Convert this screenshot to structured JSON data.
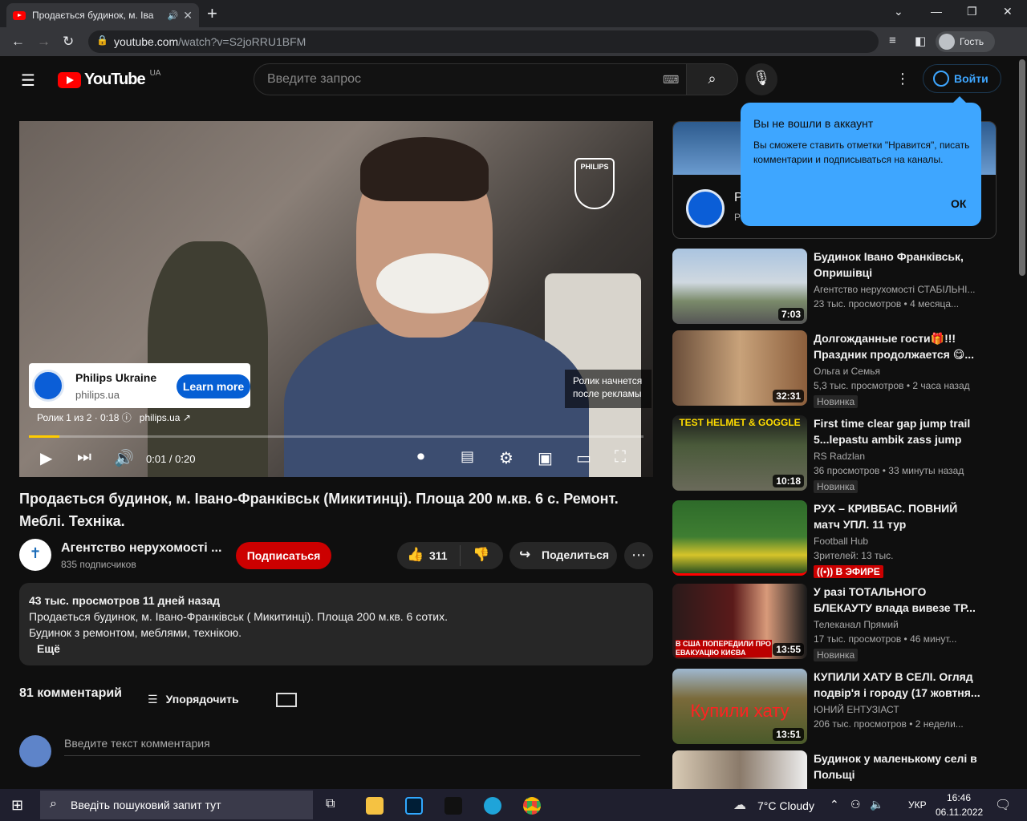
{
  "browser": {
    "tab_title": "Продається будинок, м. Іва",
    "url_host": "youtube.com",
    "url_path": "/watch?v=S2joRRU1BFM",
    "guest_label": "Гость"
  },
  "yt": {
    "logo": "YouTube",
    "region": "UA",
    "search_placeholder": "Введите запрос",
    "signin": "Войти"
  },
  "player": {
    "brand": "PHILIPS",
    "ad_name": "Philips Ukraine",
    "ad_url": "philips.ua",
    "learn_more": "Learn more",
    "ad_info": "Ролик 1 из 2 · 0:18",
    "ad_link": "philips.ua",
    "skip_text": "Ролик начнется после рекламы",
    "time": "0:01 / 0:20",
    "progress": 0.05
  },
  "video": {
    "title": "Продається будинок, м. Івано-Франківськ (Микитинці). Площа 200 м.кв. 6 с. Ремонт. Меблі. Техніка.",
    "channel": "Агентство нерухомості ...",
    "subs": "835 подписчиков",
    "subscribe": "Подписаться",
    "likes": "311",
    "share": "Поделиться"
  },
  "description": {
    "meta": "43 тыс. просмотров  11 дней назад",
    "line1": "Продається будинок, м. Івано-Франківськ ( Микитинці).  Площа 200 м.кв. 6 сотих.",
    "line2": "Будинок з ремонтом, меблями, технікою.",
    "more": "Ещё"
  },
  "comments": {
    "count": "81 комментарий",
    "sort": "Упорядочить",
    "placeholder": "Введите текст комментария"
  },
  "tooltip": {
    "heading": "Вы не вошли в аккаунт",
    "body": "Вы сможете ставить отметки \"Нравится\", писать комментарии и подписываться на каналы.",
    "ok": "ОК"
  },
  "ad_panel": {
    "name": "P",
    "sub": "P"
  },
  "recs": [
    {
      "title": "Будинок Івано Франківськ, Опришівці",
      "channel": "Агентство нерухомості СТАБІЛЬНІ...",
      "views": "23 тыс. просмотров  • 4 месяца...",
      "duration": "7:03",
      "badge": ""
    },
    {
      "title": "Долгожданные гости🎁!!! Праздник продолжается 😋...",
      "channel": "Ольга и Семья",
      "views": "5,3 тыс. просмотров  • 2 часа назад",
      "duration": "32:31",
      "badge": "Новинка"
    },
    {
      "title": "First time clear gap jump trail 5...lepastu ambik zass jump",
      "channel": "RS Radzlan",
      "views": "36 просмотров  • 33 минуты назад",
      "duration": "10:18",
      "badge": "Новинка",
      "thumb_text": "TEST HELMET & GOGGLE"
    },
    {
      "title": "РУХ – КРИВБАС. ПОВНИЙ матч УПЛ. 11 тур",
      "channel": "Football Hub",
      "views": "Зрителей: 13 тыс.",
      "duration": "",
      "live": "В ЭФИРЕ"
    },
    {
      "title": "У разі ТОТАЛЬНОГО БЛЕКАУТУ влада вивезе ТР...",
      "channel": "Телеканал Прямий",
      "views": "17 тыс. просмотров  • 46 минут...",
      "duration": "13:55",
      "badge": "Новинка",
      "thumb_text": "В США ПОПЕРЕДИЛИ ПРО ЕВАКУАЦІЮ КИЄВА"
    },
    {
      "title": "КУПИЛИ ХАТУ В СЕЛІ. Огляд подвір'я і городу (17 жовтня...",
      "channel": "ЮНИЙ ЕНТУЗІАСТ",
      "views": "206 тыс. просмотров  • 2 недели...",
      "duration": "13:51",
      "badge": "",
      "thumb_text": "Купили хату"
    },
    {
      "title": "Будинок у маленькому селі в Польщі",
      "channel": "",
      "views": "",
      "duration": "",
      "badge": ""
    }
  ],
  "taskbar": {
    "search": "Введіть пошуковий запит тут",
    "weather": "7°C  Cloudy",
    "lang": "УКР",
    "time": "16:46",
    "date": "06.11.2022"
  }
}
